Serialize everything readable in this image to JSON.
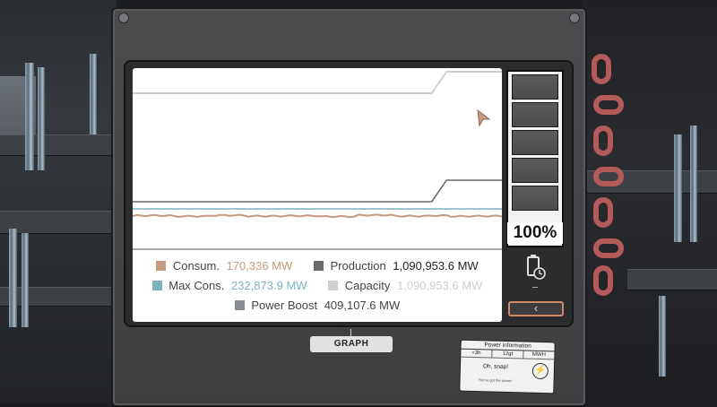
{
  "legend": {
    "consumption": {
      "label": "Consum.",
      "value": "170,336 MW",
      "color": "#c49a80"
    },
    "production": {
      "label": "Production",
      "value": "1,090,953.6 MW",
      "color": "#6b6b6b"
    },
    "max_consumption": {
      "label": "Max Cons.",
      "value": "232,873.9 MW",
      "color": "#7fb2bd"
    },
    "capacity": {
      "label": "Capacity",
      "value": "1,090,953.6 MW",
      "color": "#cfcfcf"
    },
    "power_boost": {
      "label": "Power Boost",
      "value": "409,107.6 MW",
      "color": "#8a8d93"
    }
  },
  "battery": {
    "percent_label": "100%",
    "charge_fraction": 1.0
  },
  "buttons": {
    "back": "‹",
    "graph": "GRAPH"
  },
  "info_card": {
    "title": "Power information",
    "col1": "+3h",
    "col2": "12gt",
    "col3": "MWH",
    "message": "Oh, snap!",
    "note": "You've got the power!"
  },
  "icons": {
    "battery": "battery-icon",
    "bolt": "lightning-icon",
    "back": "chevron-left-icon",
    "cursor": "pointer-icon"
  },
  "chart_data": {
    "type": "line",
    "ylim": [
      0,
      1100000
    ],
    "x": [
      0,
      10,
      20,
      30,
      40,
      50,
      60,
      70,
      80,
      81,
      85,
      90,
      100
    ],
    "series": [
      {
        "name": "Capacity",
        "values": [
          1090953.6,
          1090953.6,
          1090953.6,
          1090953.6,
          1090953.6,
          1090953.6,
          1090953.6,
          1090953.6,
          1090953.6,
          1090953.6,
          1190000,
          1190000,
          1190000
        ]
      },
      {
        "name": "Production",
        "values": [
          180000,
          180000,
          180000,
          180000,
          180000,
          180000,
          180000,
          180000,
          180000,
          180000,
          250000,
          250000,
          250000
        ]
      },
      {
        "name": "Max Cons.",
        "values": [
          160000,
          160000,
          160000,
          160000,
          160000,
          160000,
          160000,
          160000,
          160000,
          160000,
          160000,
          160000,
          160000
        ]
      },
      {
        "name": "Consum.",
        "values": [
          130000,
          132000,
          129000,
          133000,
          130000,
          131000,
          128000,
          134000,
          130000,
          131000,
          132000,
          129000,
          130000
        ]
      }
    ]
  }
}
